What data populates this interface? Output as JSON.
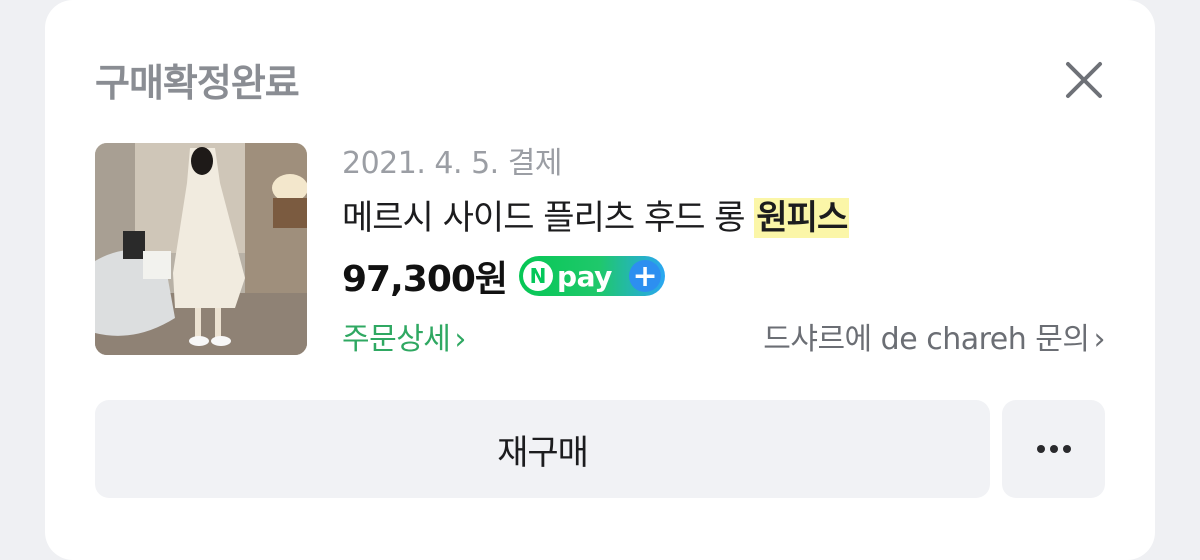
{
  "order": {
    "status": "구매확정완료",
    "date": "2021. 4. 5. 결제",
    "product_name": "메르시 사이드 플리츠 후드 롱",
    "product_name_highlight": "원피스",
    "price": "97,300원",
    "payment_badge": {
      "n": "N",
      "label": "pay",
      "plus": "+"
    },
    "order_detail_link": "주문상세",
    "seller_inquiry_link": "드샤르에 de chareh 문의",
    "chevron": "›"
  },
  "actions": {
    "rebuy_label": "재구매",
    "more_icon": "more-dots-icon"
  },
  "colors": {
    "background": "#eff0f3",
    "card": "#ffffff",
    "status_text": "#8a8d93",
    "link_green": "#2fa862",
    "highlight": "#fbf6a8",
    "npay_green": "#06c755",
    "npay_blue": "#2d8ff0"
  }
}
